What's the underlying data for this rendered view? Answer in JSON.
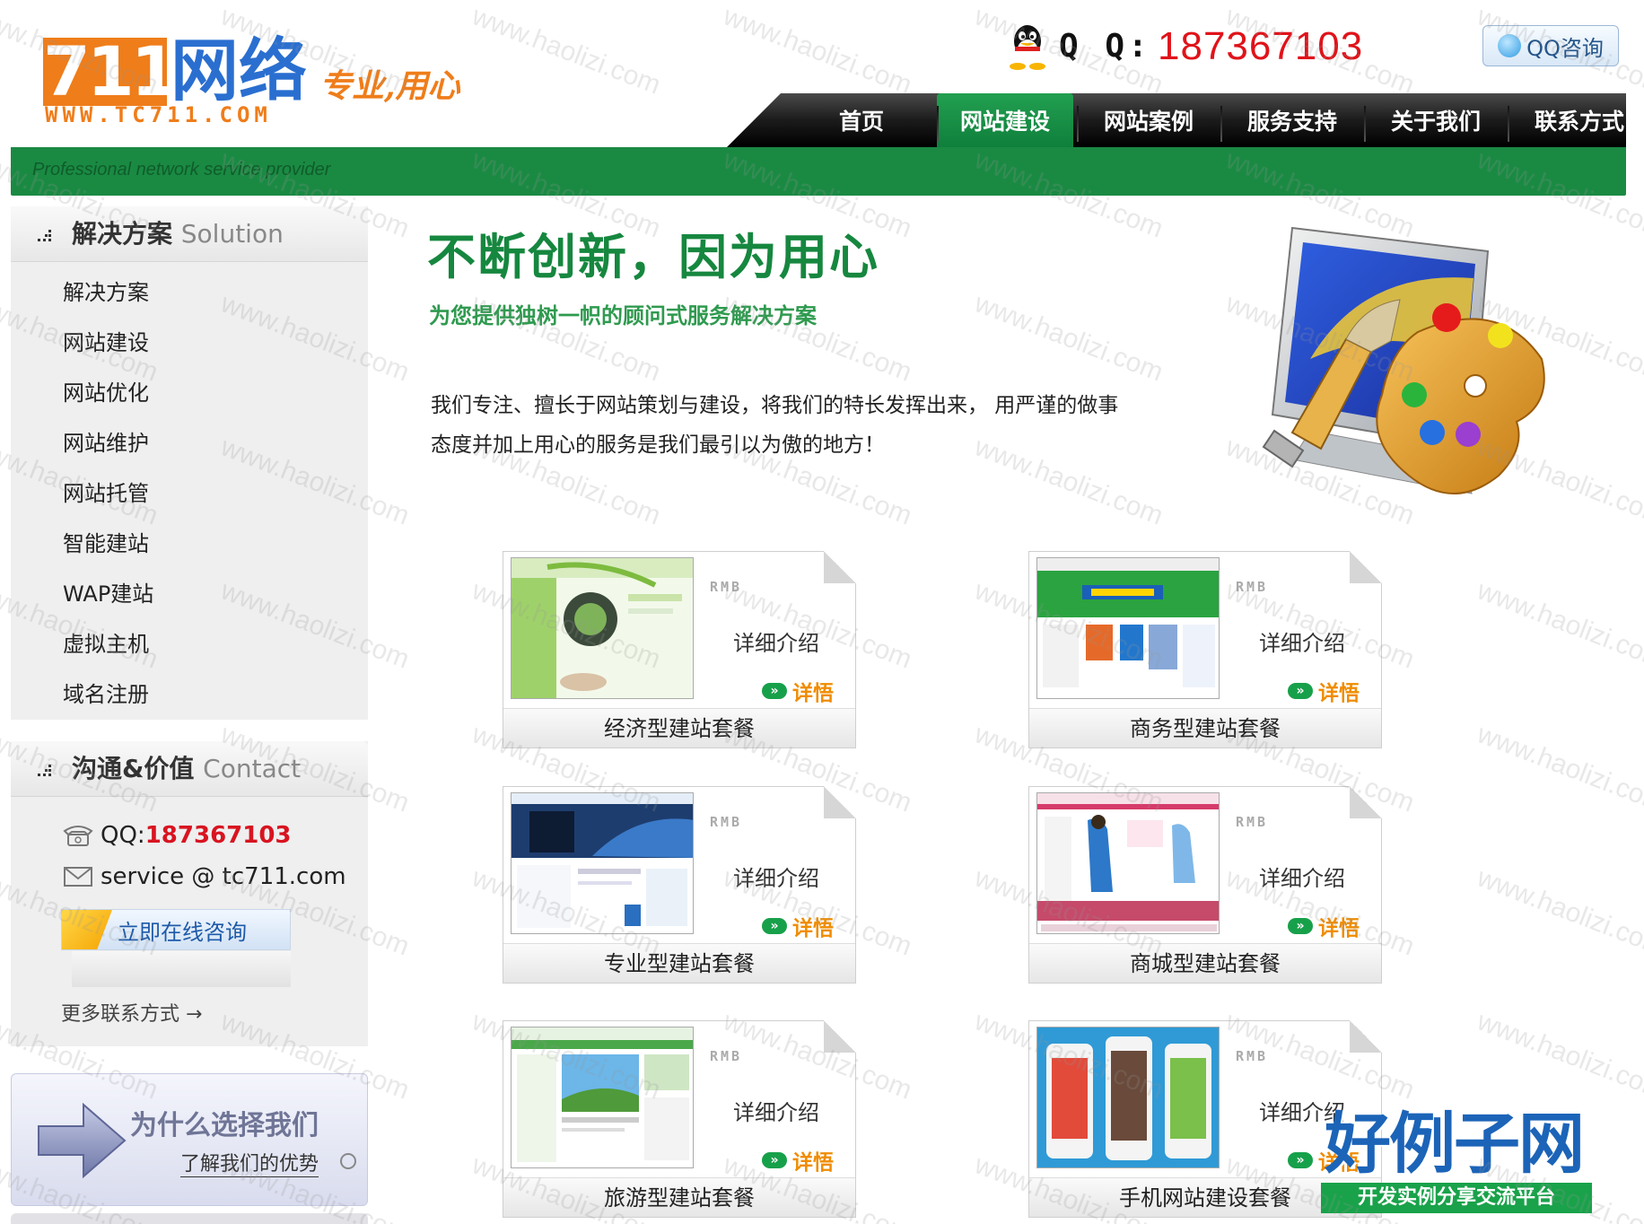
{
  "header": {
    "logo_number": "711",
    "logo_cn": "网络",
    "logo_domain": "WWW.TC711.COM",
    "logo_slogan": "专业,用心",
    "qq_label": "Q Q:",
    "qq_number": "187367103",
    "qq_consult_label": "QQ咨询",
    "tagline": "Professional network service provider"
  },
  "nav": {
    "items": [
      {
        "label": "首页"
      },
      {
        "label": "网站建设"
      },
      {
        "label": "网站案例"
      },
      {
        "label": "服务支持"
      },
      {
        "label": "关于我们"
      },
      {
        "label": "联系方式"
      }
    ],
    "active_index": 1
  },
  "sidebar": {
    "solution": {
      "title": "解决方案",
      "title_en": "Solution",
      "items": [
        {
          "label": "解决方案"
        },
        {
          "label": "网站建设"
        },
        {
          "label": "网站优化"
        },
        {
          "label": "网站维护"
        },
        {
          "label": "网站托管"
        },
        {
          "label": "智能建站"
        },
        {
          "label": "WAP建站"
        },
        {
          "label": "虚拟主机"
        },
        {
          "label": "域名注册"
        }
      ]
    },
    "contact": {
      "title": "沟通&价值",
      "title_en": "Contact",
      "qq_label": "QQ: ",
      "qq_number": "187367103",
      "email": "service @ tc711.com",
      "consult_button": "立即在线咨询",
      "more_link": "更多联系方式",
      "more_arrow": "→"
    },
    "why": {
      "title": "为什么选择我们",
      "link": "了解我们的优势"
    }
  },
  "main": {
    "hero_title": "不断创新，因为用心",
    "hero_subtitle": "为您提供独树一帜的顾问式服务解决方案",
    "intro_line1": "我们专注、擅长于网站策划与建设，将我们的特长发挥出来， 用严谨的做事",
    "intro_line2": "态度并加上用心的服务是我们最引以为傲的地方！",
    "packages": [
      {
        "name": "经济型建站套餐",
        "rmb": "RMB",
        "detail": "详细介绍",
        "more": "详悟",
        "theme": "green"
      },
      {
        "name": "商务型建站套餐",
        "rmb": "RMB",
        "detail": "详细介绍",
        "more": "详悟",
        "theme": "webeditor"
      },
      {
        "name": "专业型建站套餐",
        "rmb": "RMB",
        "detail": "详细介绍",
        "more": "详悟",
        "theme": "blue"
      },
      {
        "name": "商城型建站套餐",
        "rmb": "RMB",
        "detail": "详细介绍",
        "more": "详悟",
        "theme": "shop"
      },
      {
        "name": "旅游型建站套餐",
        "rmb": "RMB",
        "detail": "详细介绍",
        "more": "详悟",
        "theme": "travel"
      },
      {
        "name": "手机网站建设套餐",
        "rmb": "RMB",
        "detail": "详细介绍",
        "more": "详悟",
        "theme": "mobile"
      }
    ]
  },
  "brand_overlay": {
    "title": "好例子网",
    "subtitle": "开发实例分享交流平台"
  },
  "watermark": "www.haolizi.com",
  "colors": {
    "brand_green": "#1a8a43",
    "nav_active": "#17933f",
    "logo_orange": "#ef7d1a",
    "logo_blue": "#2a6fd0",
    "qq_red": "#e0131a"
  },
  "icons": [
    "qq-penguin-icon",
    "qq-bubble-icon",
    "dots-icon",
    "phone-icon",
    "mail-icon",
    "arrow-right-icon",
    "monitor-palette-icon",
    "double-arrow-icon"
  ]
}
